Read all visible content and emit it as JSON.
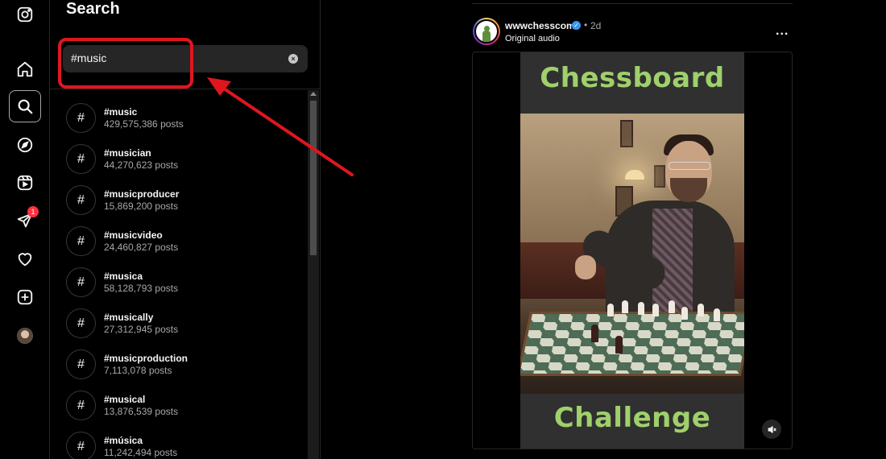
{
  "sidebar": {
    "icons": [
      {
        "name": "instagram-logo-icon"
      },
      {
        "name": "home-icon"
      },
      {
        "name": "search-icon",
        "active": true
      },
      {
        "name": "explore-compass-icon"
      },
      {
        "name": "reels-icon"
      },
      {
        "name": "messages-icon",
        "badge": "1"
      },
      {
        "name": "notifications-heart-icon"
      },
      {
        "name": "create-plus-icon"
      },
      {
        "name": "profile-avatar"
      }
    ]
  },
  "search_panel": {
    "title": "Search",
    "query": "#music",
    "clear_icon": "×",
    "hash_symbol": "#",
    "results": [
      {
        "tag": "#music",
        "posts": "429,575,386 posts"
      },
      {
        "tag": "#musician",
        "posts": "44,270,623 posts"
      },
      {
        "tag": "#musicproducer",
        "posts": "15,869,200 posts"
      },
      {
        "tag": "#musicvideo",
        "posts": "24,460,827 posts"
      },
      {
        "tag": "#musica",
        "posts": "58,128,793 posts"
      },
      {
        "tag": "#musically",
        "posts": "27,312,945 posts"
      },
      {
        "tag": "#musicproduction",
        "posts": "7,113,078 posts"
      },
      {
        "tag": "#musical",
        "posts": "13,876,539 posts"
      },
      {
        "tag": "#música",
        "posts": "11,242,494 posts"
      }
    ]
  },
  "annotation": {
    "color": "#e0161e"
  },
  "post": {
    "username": "wwwchesscom",
    "verified_mark": "✓",
    "separator": "•",
    "time": "2d",
    "audio": "Original audio",
    "more": "...",
    "video_caption_top": "Chessboard",
    "video_caption_bottom": "Challenge",
    "caption_color": "#9fd06c"
  }
}
